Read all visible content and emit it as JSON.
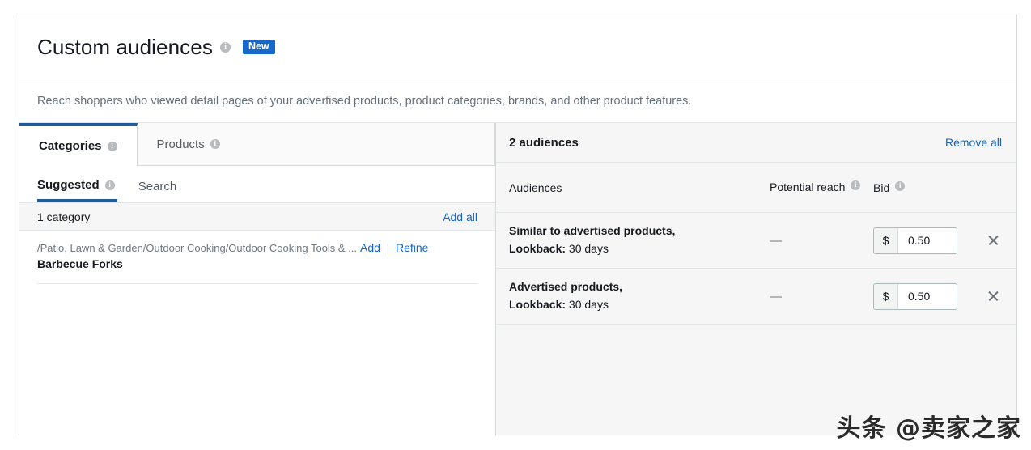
{
  "card": {
    "title": "Custom audiences",
    "title_info_icon": "info-icon",
    "new_badge": "New",
    "description": "Reach shoppers who viewed detail pages of your advertised products, product categories, brands, and other product features."
  },
  "tabs": [
    {
      "label": "Categories",
      "active": true,
      "info_icon": "info-icon"
    },
    {
      "label": "Products",
      "active": false,
      "info_icon": "info-icon"
    }
  ],
  "subtabs": [
    {
      "label": "Suggested",
      "active": true,
      "info_icon": "info-icon"
    },
    {
      "label": "Search",
      "active": false
    }
  ],
  "category_list": {
    "count_label": "1 category",
    "add_all_label": "Add all",
    "rows": [
      {
        "path": "/Patio, Lawn & Garden/Outdoor Cooking/Outdoor Cooking Tools & ...",
        "name": "Barbecue Forks",
        "add_label": "Add",
        "refine_label": "Refine"
      }
    ]
  },
  "audiences_panel": {
    "count_label": "2 audiences",
    "remove_all_label": "Remove all",
    "columns": {
      "audiences": "Audiences",
      "potential_reach": "Potential reach",
      "potential_reach_info_icon": "info-icon",
      "bid": "Bid",
      "bid_info_icon": "info-icon"
    },
    "rows": [
      {
        "name": "Similar to advertised products,",
        "lookback_label": "Lookback:",
        "lookback_value": "30 days",
        "potential_reach": "—",
        "bid_currency": "$",
        "bid_value": "0.50",
        "remove_icon": "close-icon"
      },
      {
        "name": "Advertised products,",
        "lookback_label": "Lookback:",
        "lookback_value": "30 days",
        "potential_reach": "—",
        "bid_currency": "$",
        "bid_value": "0.50",
        "remove_icon": "close-icon"
      }
    ]
  },
  "watermark": {
    "text": "头条 @卖家之家"
  },
  "colors": {
    "accent_blue": "#1f5c99",
    "link_blue": "#1565c0",
    "badge_blue": "#1768c9",
    "panel_gray": "#f6f6f6",
    "border_gray": "#e3e6e6",
    "muted_text": "#64707a"
  }
}
